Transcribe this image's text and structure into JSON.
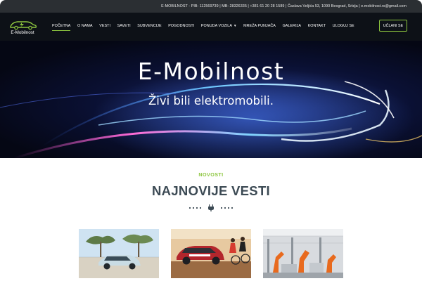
{
  "topbar": {
    "info": "E-MOBILNOST - PIB: 112569739 | MB: 28326335 | +381 61 20 28 1589 | Časlava Veljića 53, 1090 Beograd, Srbija | e.mobilnost.rs@gmail.com"
  },
  "header": {
    "logo_text": "E-Mobilnost",
    "nav": [
      {
        "label": "Početna",
        "active": true
      },
      {
        "label": "O nama"
      },
      {
        "label": "Vesti"
      },
      {
        "label": "Saveti"
      },
      {
        "label": "Subvencije"
      },
      {
        "label": "Pogodnosti"
      },
      {
        "label": "Ponuda vozila",
        "has_dropdown": true
      },
      {
        "label": "Mreža punjača"
      },
      {
        "label": "Galerija"
      },
      {
        "label": "Kontakt"
      },
      {
        "label": "Uloguj se"
      }
    ],
    "cta_label": "Učlani se"
  },
  "hero": {
    "title": "E-Mobilnost",
    "subtitle": "Živi bili elektromobili."
  },
  "news": {
    "eyebrow": "NOVOSTI",
    "title": "NAJNOVIJE VESTI"
  },
  "colors": {
    "accent": "#8dc63f",
    "topbar_bg": "#2b2f33",
    "header_bg": "#0d1117",
    "heading": "#3c4a54"
  },
  "icons": [
    "car-logo-icon",
    "plug-icon",
    "chevron-down-icon"
  ]
}
